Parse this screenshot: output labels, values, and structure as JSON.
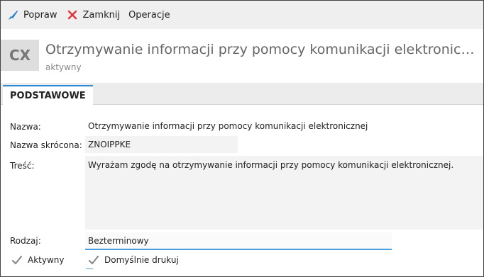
{
  "toolbar": {
    "edit_label": "Popraw",
    "close_label": "Zamknij",
    "operations_label": "Operacje"
  },
  "header": {
    "avatar_text": "CX",
    "title": "Otrzymywanie informacji przy pomocy komunikacji elektronicznej",
    "status": "aktywny"
  },
  "tabs": [
    {
      "label": "PODSTAWOWE"
    }
  ],
  "form": {
    "name": {
      "label": "Nazwa:",
      "value": "Otrzymywanie informacji przy pomocy komunikacji elektronicznej"
    },
    "short_name": {
      "label": "Nazwa skrócona:",
      "value": "ZNOIPPKE"
    },
    "content": {
      "label": "Treść:",
      "value": "Wyrażam zgodę na otrzymywanie informacji przy pomocy komunikacji elektronicznej."
    },
    "type": {
      "label": "Rodzaj:",
      "value": "Bezterminowy"
    },
    "active": {
      "label": "Aktywny",
      "checked": true
    },
    "default_print": {
      "label": "Domyślnie drukuj",
      "checked": true
    }
  },
  "colors": {
    "accent": "#2a88d8",
    "close_icon": "#e0303a",
    "edit_icon": "#1e7ad0",
    "check": "#8a8a8a"
  }
}
